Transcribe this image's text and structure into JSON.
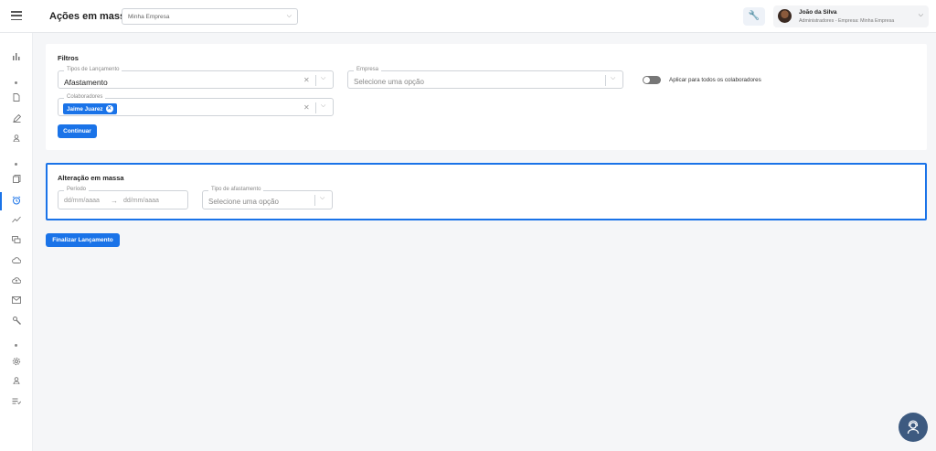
{
  "header": {
    "page_title": "Ações em massa",
    "company_select": "Minha Empresa",
    "user": {
      "name": "João da Silva",
      "role": "Administradores - Empresa: Minha Empresa"
    }
  },
  "sidebar": {
    "icons": [
      "chart-icon",
      "document-icon",
      "pen-icon",
      "person-icon",
      "documents-icon",
      "alarm-icon",
      "trend-icon",
      "chat-icon",
      "cloud-icon",
      "cloud-upload-icon",
      "mail-icon",
      "tool-icon",
      "settings-icon",
      "user-icon",
      "list-icon"
    ],
    "active": "alarm-icon"
  },
  "filtros": {
    "title": "Filtros",
    "tipos_lancamento": {
      "label": "Tipos de Lançamento",
      "value": "Afastamento"
    },
    "empresa": {
      "label": "Empresa",
      "placeholder": "Selecione uma opção"
    },
    "toggle_label": "Aplicar para todos os colaboradores",
    "colaboradores": {
      "label": "Colaboradores",
      "chips": [
        "Jaime Juarez"
      ]
    },
    "continue_button": "Continuar"
  },
  "alteracao": {
    "title": "Alteração em massa",
    "periodo": {
      "label": "Período",
      "start_placeholder": "dd/mm/aaaa",
      "end_placeholder": "dd/mm/aaaa"
    },
    "tipo_afastamento": {
      "label": "Tipo de afastamento",
      "placeholder": "Selecione uma opção"
    }
  },
  "finalizar_button": "Finalizar Lançamento",
  "colors": {
    "primary": "#1a73e8",
    "fab": "#3d5a80"
  }
}
